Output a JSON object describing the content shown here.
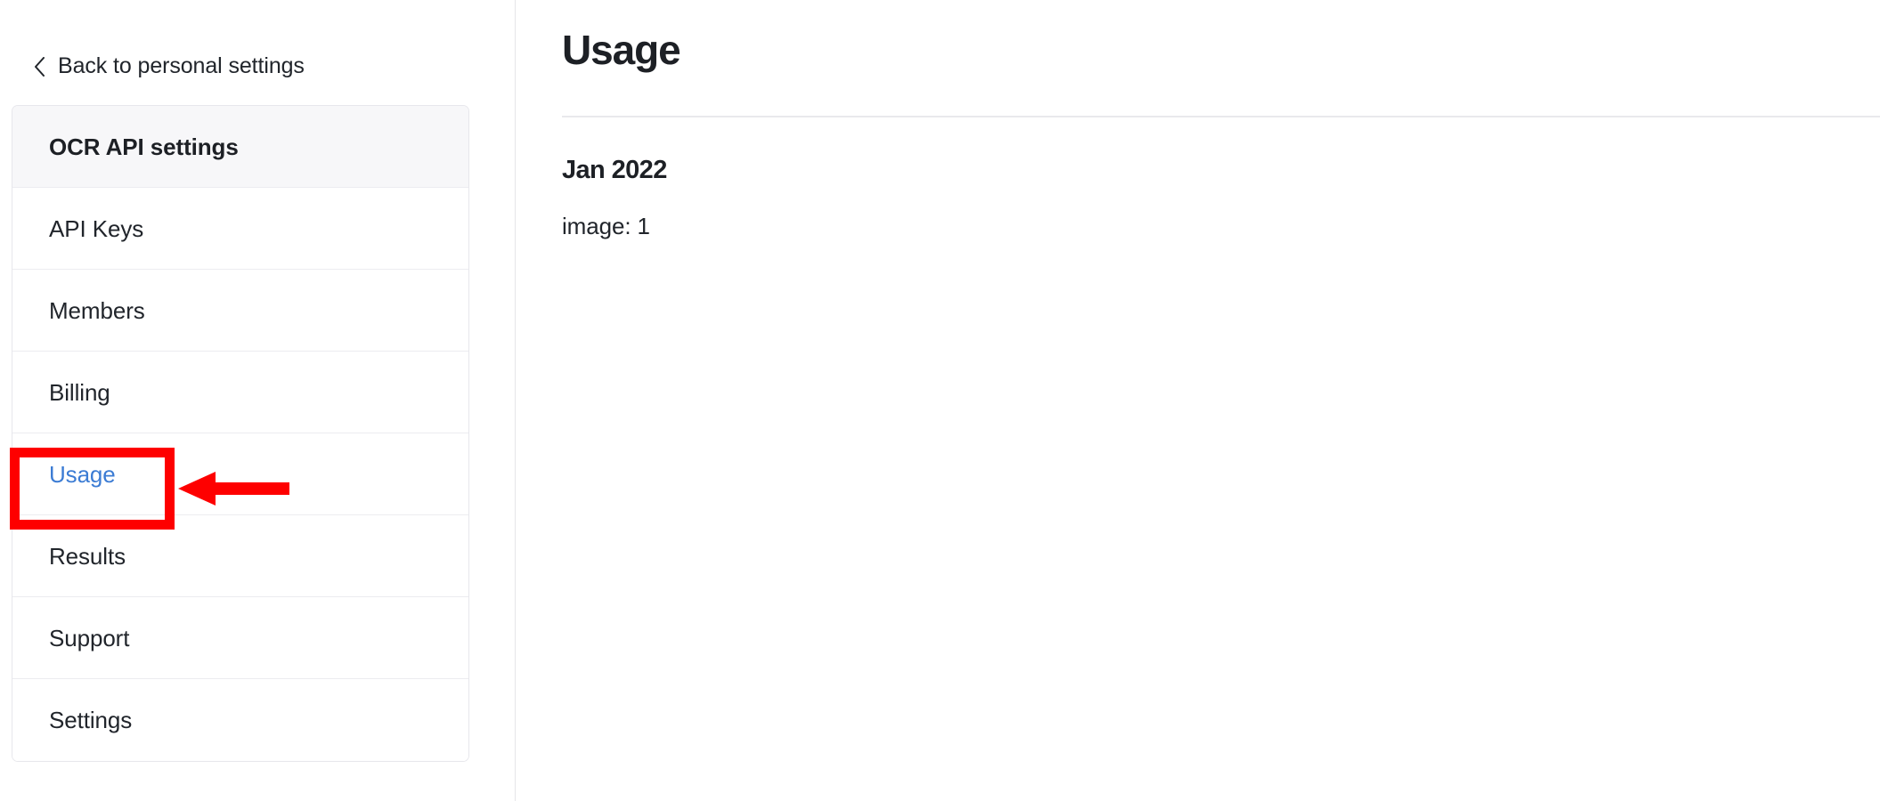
{
  "sidebar": {
    "back_link": {
      "label": "Back to personal settings",
      "icon": "chevron-left-icon"
    },
    "header": {
      "label": "OCR API settings"
    },
    "items": [
      {
        "label": "API Keys",
        "active": false
      },
      {
        "label": "Members",
        "active": false
      },
      {
        "label": "Billing",
        "active": false
      },
      {
        "label": "Usage",
        "active": true
      },
      {
        "label": "Results",
        "active": false
      },
      {
        "label": "Support",
        "active": false
      },
      {
        "label": "Settings",
        "active": false
      }
    ]
  },
  "main": {
    "title": "Usage",
    "month": "Jan 2022",
    "usage_line": "image: 1"
  },
  "annotation": {
    "highlight_target": "Usage",
    "box_color": "#fe0000",
    "arrow_color": "#fe0000",
    "arrow_direction": "left"
  },
  "colors": {
    "link_blue": "#3c7cd4",
    "text": "#21252b",
    "heading": "#1d2025",
    "border": "#e7e7ec",
    "header_row_bg": "#f7f7f9",
    "divider": "#e6e6e9"
  }
}
